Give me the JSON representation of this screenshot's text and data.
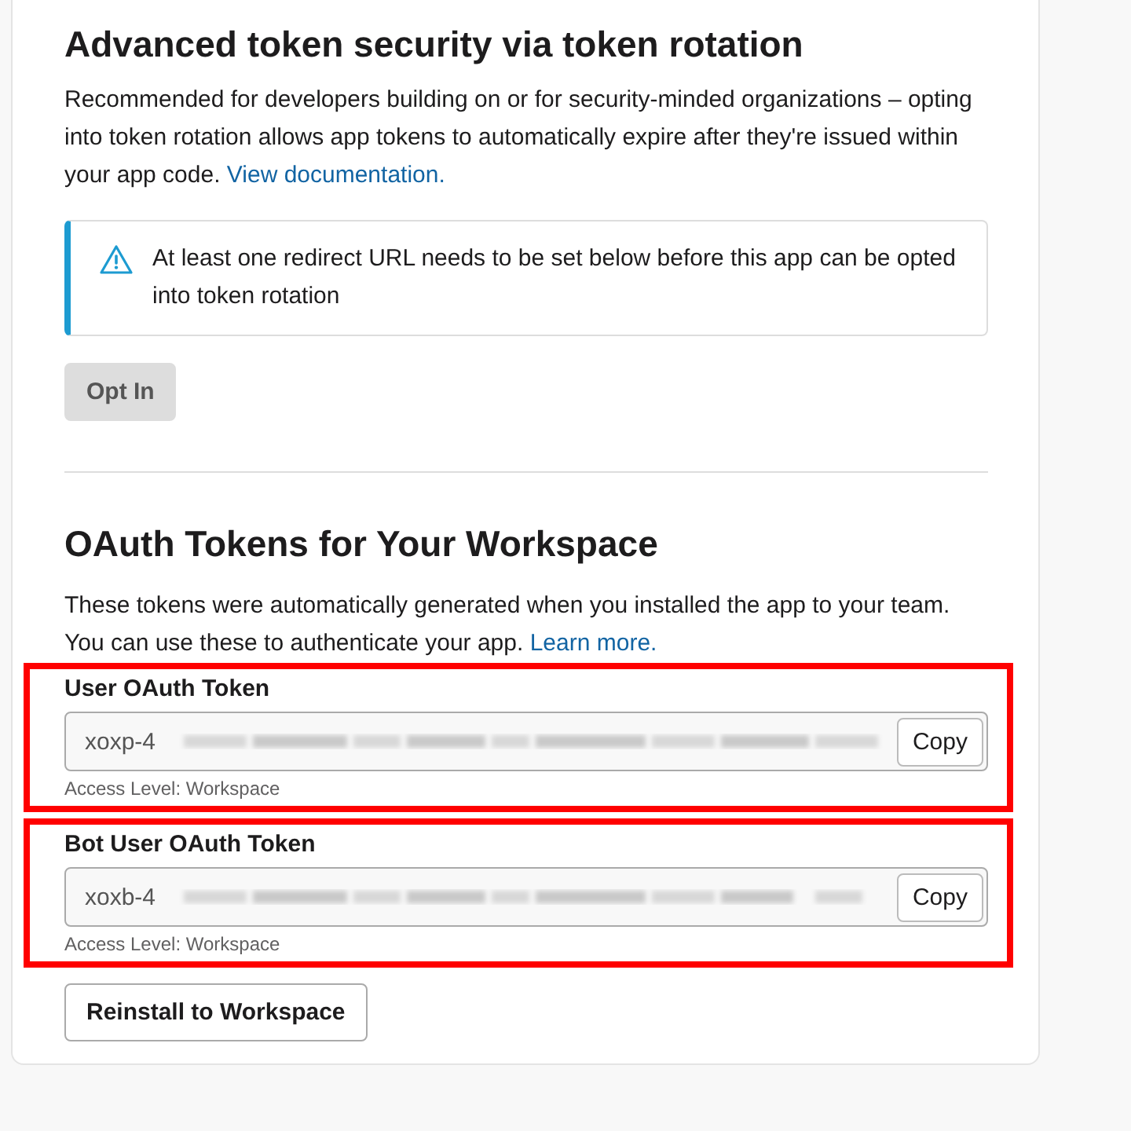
{
  "rotation_section": {
    "heading": "Advanced token security via token rotation",
    "description": "Recommended for developers building on or for security-minded organizations – opting into token rotation allows app tokens to automatically expire after they're issued within your app code.",
    "link": "View documentation.",
    "alert": "At least one redirect URL needs to be set below before this app can be opted into token rotation",
    "button": {
      "label": "Opt In",
      "disabled": true
    }
  },
  "tokens_section": {
    "heading": "OAuth Tokens for Your Workspace",
    "description": "These tokens were automatically generated when you installed the app to your team. You can use these to authenticate your app.",
    "link": "Learn more.",
    "tokens": [
      {
        "label": "User OAuth Token",
        "value": "xoxp-4",
        "copy_label": "Copy",
        "access_level": "Access Level: Workspace",
        "highlighted": true
      },
      {
        "label": "Bot User OAuth Token",
        "value": "xoxb-4",
        "copy_label": "Copy",
        "access_level": "Access Level: Workspace",
        "highlighted": true
      }
    ],
    "button": "Reinstall to Workspace"
  }
}
